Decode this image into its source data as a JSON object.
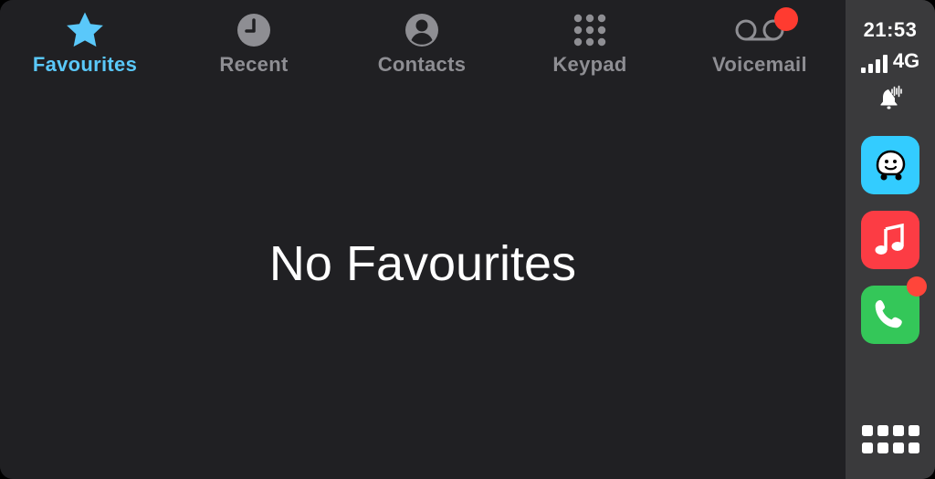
{
  "tabs": [
    {
      "label": "Favourites",
      "icon": "star-icon",
      "active": true
    },
    {
      "label": "Recent",
      "icon": "clock-icon",
      "active": false
    },
    {
      "label": "Contacts",
      "icon": "person-icon",
      "active": false
    },
    {
      "label": "Keypad",
      "icon": "keypad-icon",
      "active": false
    },
    {
      "label": "Voicemail",
      "icon": "voicemail-icon",
      "active": false,
      "badge": true
    }
  ],
  "main": {
    "empty_message": "No Favourites"
  },
  "status": {
    "time": "21:53",
    "network": "4G",
    "signal_bars": 4
  },
  "dock": [
    {
      "app": "Waze",
      "icon": "waze-icon",
      "color": "#33ccff"
    },
    {
      "app": "Music",
      "icon": "music-note-icon",
      "color": "#fc3c44"
    },
    {
      "app": "Phone",
      "icon": "phone-icon",
      "color": "#34c759",
      "badge": true
    }
  ],
  "colors": {
    "accent": "#5ac8fa",
    "inactive": "#8e8e93",
    "badge": "#ff3b30",
    "background": "#202023",
    "sidebar": "#3a3a3c"
  }
}
